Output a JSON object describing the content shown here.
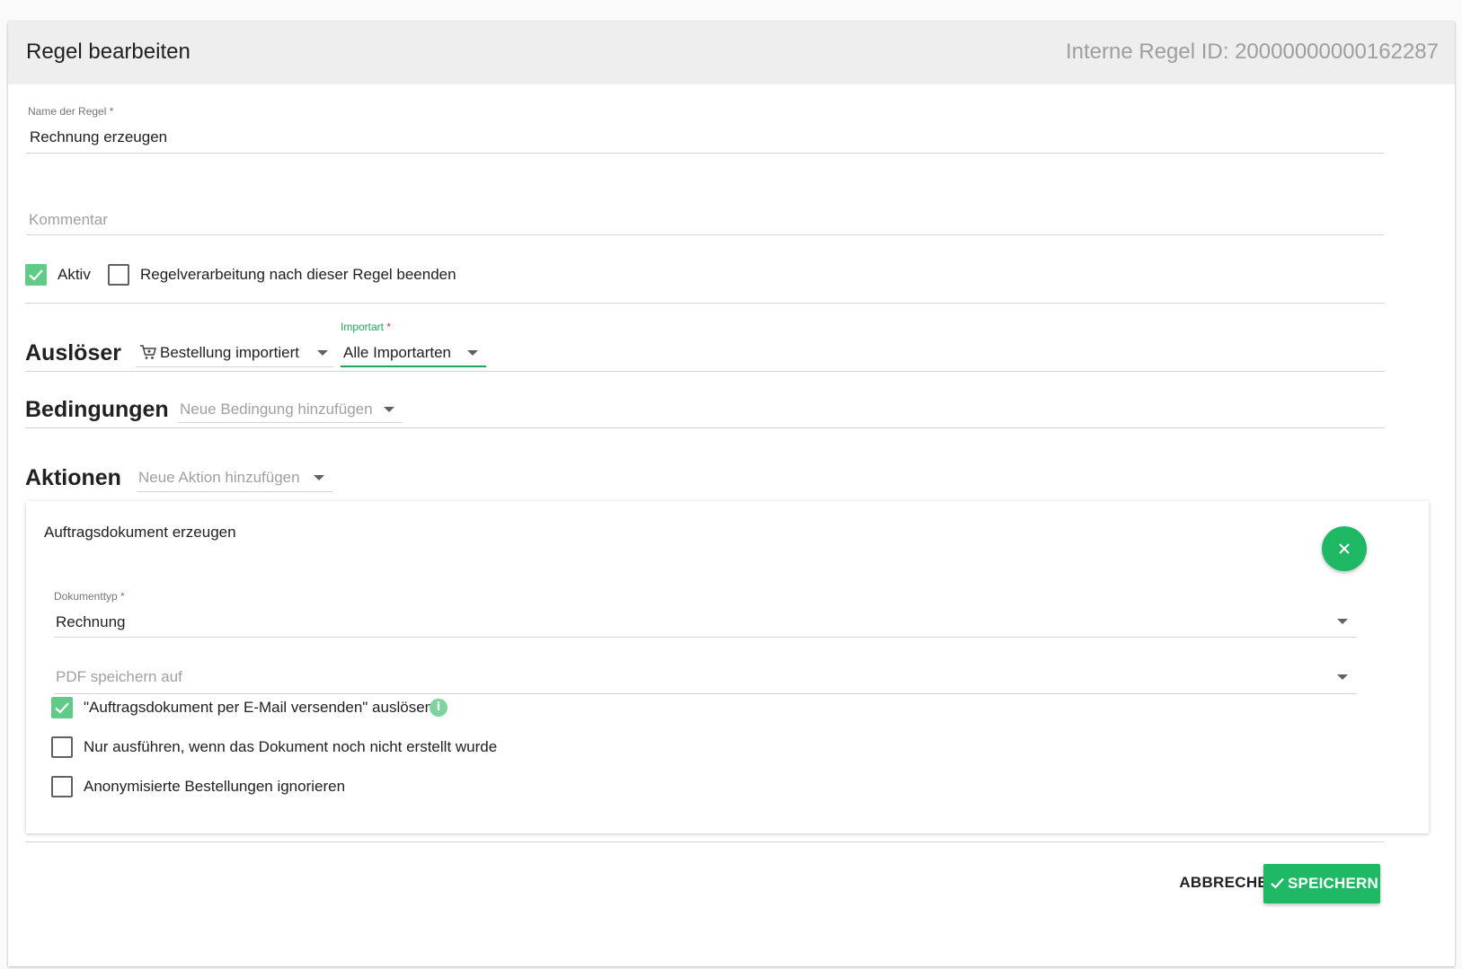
{
  "header": {
    "title": "Regel bearbeiten",
    "rule_id": "Interne Regel ID: 20000000000162287"
  },
  "rule_name": {
    "label": "Name der Regel",
    "required_mark": "*",
    "value": "Rechnung erzeugen"
  },
  "comment": {
    "placeholder": "Kommentar"
  },
  "options": {
    "active_label": "Aktiv",
    "active_checked": true,
    "stop_label": "Regelverarbeitung nach dieser Regel beenden",
    "stop_checked": false
  },
  "trigger": {
    "section_label": "Auslöser",
    "event_icon": "cart-icon",
    "event_value": "Bestellung importiert",
    "import_type_label": "Importart",
    "import_type_required": "*",
    "import_type_value": "Alle Importarten"
  },
  "conditions": {
    "section_label": "Bedingungen",
    "add_placeholder": "Neue Bedingung hinzufügen"
  },
  "actions": {
    "section_label": "Aktionen",
    "add_placeholder": "Neue Aktion hinzufügen",
    "card": {
      "title": "Auftragsdokument erzeugen",
      "remove_icon": "close-icon",
      "doc_type_label": "Dokumenttyp",
      "doc_type_required": "*",
      "doc_type_value": "Rechnung",
      "pdf_placeholder": "PDF speichern auf",
      "send_email_label": "\"Auftragsdokument per E-Mail versenden\" auslösen",
      "send_email_checked": true,
      "info_icon": "info-icon",
      "only_if_not_created_label": "Nur ausführen, wenn das Dokument noch nicht erstellt wurde",
      "only_if_not_created_checked": false,
      "ignore_anonymized_label": "Anonymisierte Bestellungen ignorieren",
      "ignore_anonymized_checked": false
    }
  },
  "footer": {
    "cancel_label": "ABBRECHEN",
    "save_label": "SPEICHERN",
    "save_icon": "check-icon"
  },
  "colors": {
    "accent": "#1fb864",
    "checkbox_checked": "#5fcb86",
    "header_bg": "#eeeeee"
  }
}
